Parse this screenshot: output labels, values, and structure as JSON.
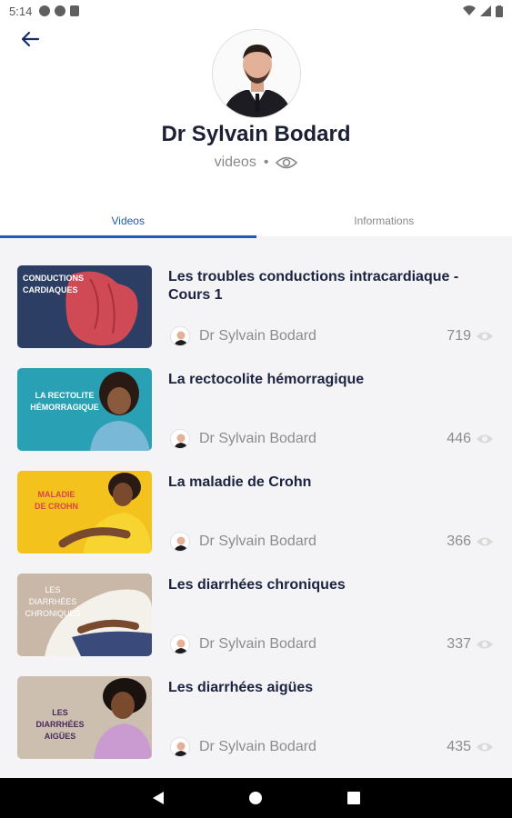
{
  "status": {
    "time": "5:14"
  },
  "profile": {
    "name": "Dr Sylvain  Bodard",
    "videos_label": "videos",
    "separator": "•"
  },
  "tabs": [
    {
      "label": "Videos",
      "active": true
    },
    {
      "label": "Informations",
      "active": false
    }
  ],
  "videos": [
    {
      "title": "Les troubles conductions intracardiaque - Cours 1",
      "author": "Dr Sylvain  Bodard",
      "views": "719",
      "thumb_text": "CONDUCTIONS CARDIAQUES",
      "thumb_bg": "#2c3e63",
      "thumb_accent": "#d04a55"
    },
    {
      "title": "La rectocolite hémorragique",
      "author": "Dr Sylvain  Bodard",
      "views": "446",
      "thumb_text": "LA RECTOLITE HÉMORRAGIQUE",
      "thumb_bg": "#2aa0b4",
      "thumb_accent": "#7ab8d8"
    },
    {
      "title": "La maladie de Crohn",
      "author": "Dr Sylvain  Bodard",
      "views": "366",
      "thumb_text": "MALADIE DE CROHN",
      "thumb_bg": "#f3c21c",
      "thumb_accent": "#d94747"
    },
    {
      "title": "Les diarrhées chroniques",
      "author": "Dr Sylvain  Bodard",
      "views": "337",
      "thumb_text": "LES DIARRHÉES CHRONIQUES",
      "thumb_bg": "#c9b8a8",
      "thumb_accent": "#f4f0ea"
    },
    {
      "title": "Les diarrhées aigües",
      "author": "Dr Sylvain  Bodard",
      "views": "435",
      "thumb_text": "LES DIARRHÉES AIGÜES",
      "thumb_bg": "#cdbfb0",
      "thumb_accent": "#c99bd0"
    }
  ],
  "colors": {
    "accent": "#1f5bbf",
    "title": "#1b2340",
    "muted": "#8c8c8c"
  }
}
